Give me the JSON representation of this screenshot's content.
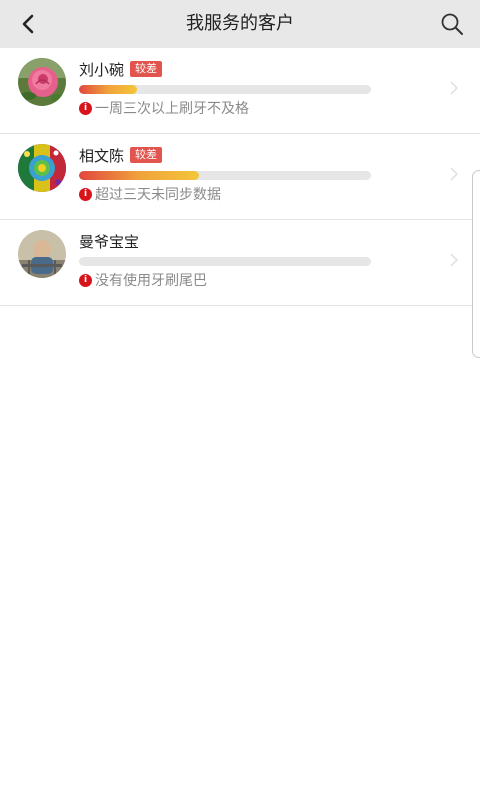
{
  "header": {
    "title": "我服务的客户",
    "back_icon": "chevron-left-icon",
    "search_icon": "search-icon"
  },
  "colors": {
    "badge": "#e2544e",
    "bar_start": "#e2463f",
    "bar_end": "#f3c63a",
    "info": "#d8141b"
  },
  "customers": [
    {
      "name": "刘小碗",
      "badge": "较差",
      "progress": 0.2,
      "status": "一周三次以上刷牙不及格",
      "avatar": "rose-avatar"
    },
    {
      "name": "相文陈",
      "badge": "较差",
      "progress": 0.41,
      "status": "超过三天未同步数据",
      "avatar": "colorful-avatar"
    },
    {
      "name": "曼爷宝宝",
      "badge": "",
      "progress": 0,
      "status": "没有使用牙刷尾巴",
      "avatar": "baby-photo-avatar"
    }
  ]
}
